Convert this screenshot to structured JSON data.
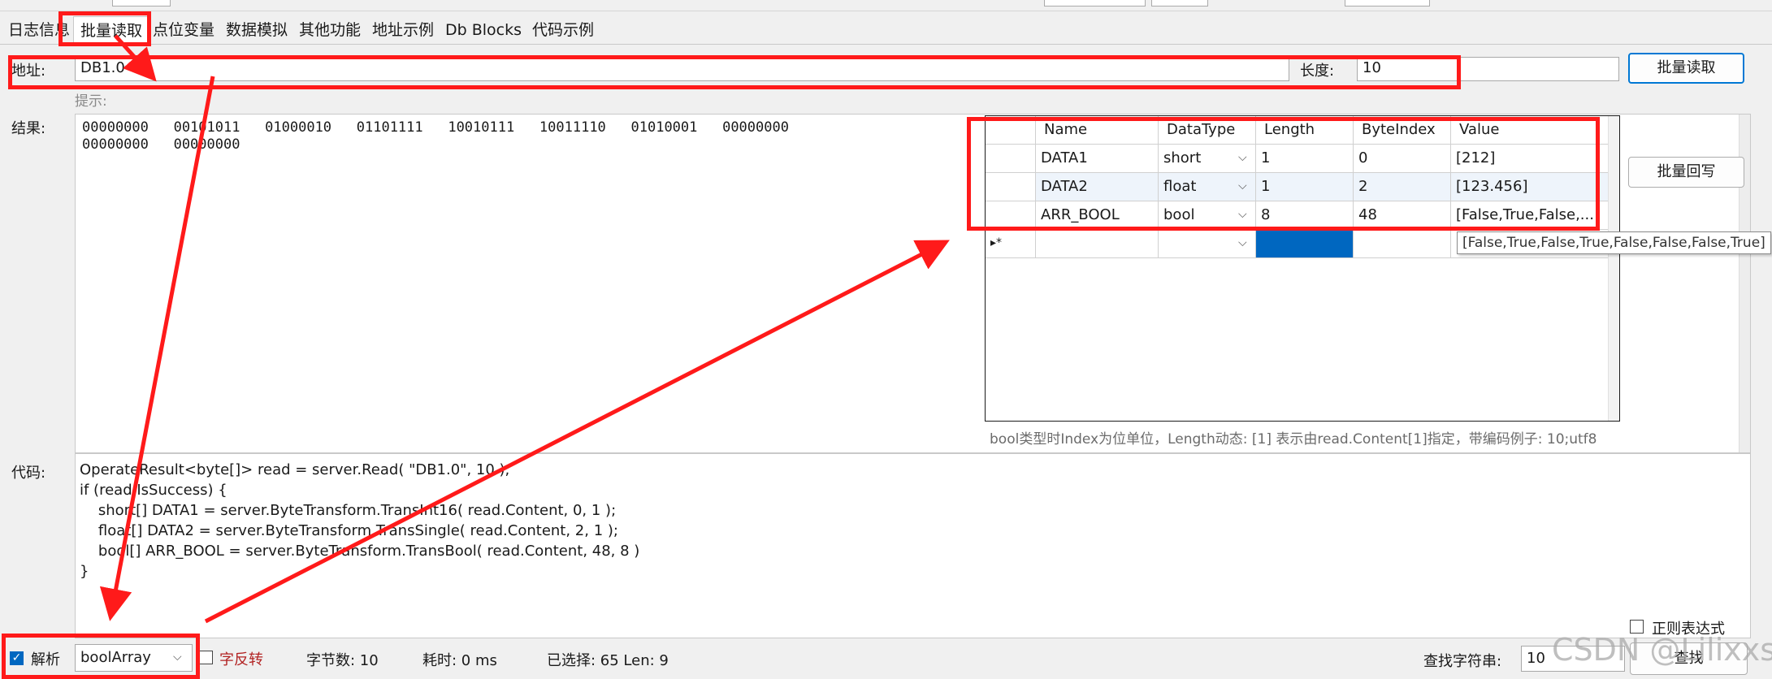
{
  "tabs": [
    {
      "label": "日志信息"
    },
    {
      "label": "批量读取"
    },
    {
      "label": "点位变量"
    },
    {
      "label": "数据模拟"
    },
    {
      "label": "其他功能"
    },
    {
      "label": "地址示例"
    },
    {
      "label": "Db Blocks"
    },
    {
      "label": "代码示例"
    }
  ],
  "address": {
    "label": "地址:",
    "value": "DB1.0",
    "hint": "提示:"
  },
  "length": {
    "label": "长度:",
    "value": "10"
  },
  "buttons": {
    "batch_read": "批量读取",
    "batch_write": "批量回写",
    "search": "查找"
  },
  "result": {
    "label": "结果:",
    "line1": "00000000   00101011   01000010   01101111   10010111   10011110   01010001   00000000",
    "line2": "00000000   00000000"
  },
  "grid": {
    "columns": [
      "Name",
      "DataType",
      "Length",
      "ByteIndex",
      "Value"
    ],
    "rows": [
      {
        "name": "DATA1",
        "type": "short",
        "length": "1",
        "index": "0",
        "value": "[212]"
      },
      {
        "name": "DATA2",
        "type": "float",
        "length": "1",
        "index": "2",
        "value": "[123.456]"
      },
      {
        "name": "ARR_BOOL",
        "type": "bool",
        "length": "8",
        "index": "48",
        "value": "[False,True,False,..."
      }
    ],
    "new_row_marker": "▸*",
    "tooltip": "[False,True,False,True,False,False,False,True]",
    "note": "bool类型时Index为位单位，Length动态: [1] 表示由read.Content[1]指定，带编码例子: 10;utf8"
  },
  "code": {
    "label": "代码:",
    "lines": [
      "OperateResult<byte[]> read = server.Read( \"DB1.0\", 10 );",
      "if (read.IsSuccess) {",
      "    short[] DATA1 = server.ByteTransform.TransInt16( read.Content, 0, 1 );",
      "    float[] DATA2 = server.ByteTransform.TransSingle( read.Content, 2, 1 );",
      "    bool[] ARR_BOOL = server.ByteTransform.TransBool( read.Content, 48, 8 )",
      "}"
    ]
  },
  "bottom": {
    "parse_label": "解析",
    "parse_checked": true,
    "parse_type": "boolArray",
    "reverse_label": "字反转",
    "byte_count": "字节数: 10",
    "elapsed": "耗时:  0 ms",
    "selected": "已选择: 65 Len: 9",
    "regex_label": "正则表达式",
    "search_label": "查找字符串:",
    "search_value": "10",
    "watermark": "CSDN @Lilixxs"
  },
  "colors": {
    "annotation": "#ff1a1a",
    "selection": "#0067c0",
    "accent": "#0078d4"
  }
}
